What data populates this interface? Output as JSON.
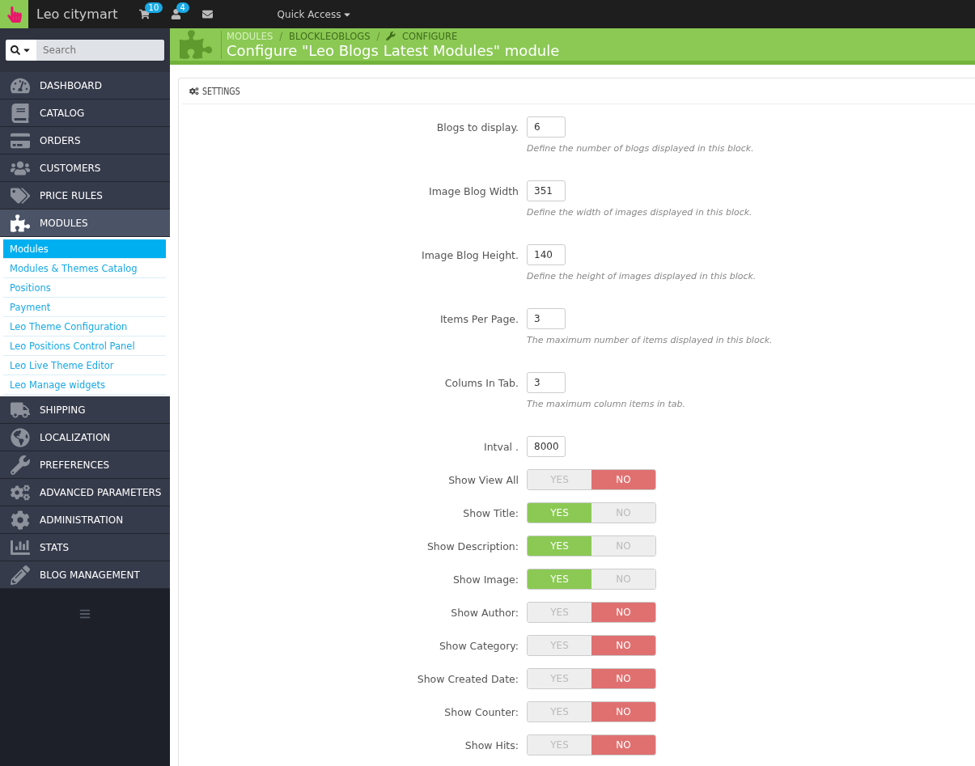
{
  "header": {
    "shop_name": "Leo citymart",
    "badges": [
      {
        "count": "10"
      },
      {
        "count": "4"
      }
    ],
    "quick_access": "Quick Access"
  },
  "sidebar": {
    "search": {
      "placeholder": "Search"
    },
    "items": [
      {
        "label": "DASHBOARD",
        "selected": false
      },
      {
        "label": "CATALOG",
        "selected": false
      },
      {
        "label": "ORDERS",
        "selected": false
      },
      {
        "label": "CUSTOMERS",
        "selected": false
      },
      {
        "label": "PRICE RULES",
        "selected": false
      },
      {
        "label": "MODULES",
        "selected": true,
        "children": [
          {
            "label": "Modules",
            "selected": true
          },
          {
            "label": "Modules & Themes Catalog",
            "selected": false
          },
          {
            "label": "Positions",
            "selected": false
          },
          {
            "label": "Payment",
            "selected": false
          },
          {
            "label": "Leo Theme Configuration",
            "selected": false
          },
          {
            "label": "Leo Positions Control Panel",
            "selected": false
          },
          {
            "label": "Leo Live Theme Editor",
            "selected": false
          },
          {
            "label": "Leo Manage widgets",
            "selected": false
          }
        ]
      },
      {
        "label": "SHIPPING",
        "selected": false
      },
      {
        "label": "LOCALIZATION",
        "selected": false
      },
      {
        "label": "PREFERENCES",
        "selected": false
      },
      {
        "label": "ADVANCED PARAMETERS",
        "selected": false
      },
      {
        "label": "ADMINISTRATION",
        "selected": false
      },
      {
        "label": "STATS",
        "selected": false
      },
      {
        "label": "BLOG MANAGEMENT",
        "selected": false
      }
    ]
  },
  "page_header": {
    "separator": "/",
    "breadcrumb": [
      "MODULES",
      "BLOCKLEOBLOGS",
      "CONFIGURE"
    ],
    "title": "Configure \"Leo Blogs Latest Modules\" module"
  },
  "panel": {
    "title": "SETTINGS",
    "fields": [
      {
        "kind": "text",
        "label": "Blogs to display.",
        "value": "6",
        "help": "Define the number of blogs displayed in this block."
      },
      {
        "kind": "text",
        "label": "Image Blog Width",
        "value": "351",
        "help": "Define the width of images displayed in this block."
      },
      {
        "kind": "text",
        "label": "Image Blog Height.",
        "value": "140",
        "help": "Define the height of images displayed in this block."
      },
      {
        "kind": "text",
        "label": "Items Per Page.",
        "value": "3",
        "help": "The maximum number of items displayed in this block."
      },
      {
        "kind": "text",
        "label": "Colums In Tab.",
        "value": "3",
        "help": "The maximum column items in tab."
      },
      {
        "kind": "text",
        "label": "Intval .",
        "value": "8000"
      },
      {
        "kind": "switch",
        "label": "Show View All",
        "yes": "YES",
        "no": "NO",
        "on": false
      },
      {
        "kind": "switch",
        "label": "Show Title:",
        "yes": "YES",
        "no": "NO",
        "on": true
      },
      {
        "kind": "switch",
        "label": "Show Description:",
        "yes": "YES",
        "no": "NO",
        "on": true
      },
      {
        "kind": "switch",
        "label": "Show Image:",
        "yes": "YES",
        "no": "NO",
        "on": true
      },
      {
        "kind": "switch",
        "label": "Show Author:",
        "yes": "YES",
        "no": "NO",
        "on": false
      },
      {
        "kind": "switch",
        "label": "Show Category:",
        "yes": "YES",
        "no": "NO",
        "on": false
      },
      {
        "kind": "switch",
        "label": "Show Created Date:",
        "yes": "YES",
        "no": "NO",
        "on": false
      },
      {
        "kind": "switch",
        "label": "Show Counter:",
        "yes": "YES",
        "no": "NO",
        "on": false
      },
      {
        "kind": "switch",
        "label": "Show Hits:",
        "yes": "YES",
        "no": "NO",
        "on": false
      }
    ]
  }
}
